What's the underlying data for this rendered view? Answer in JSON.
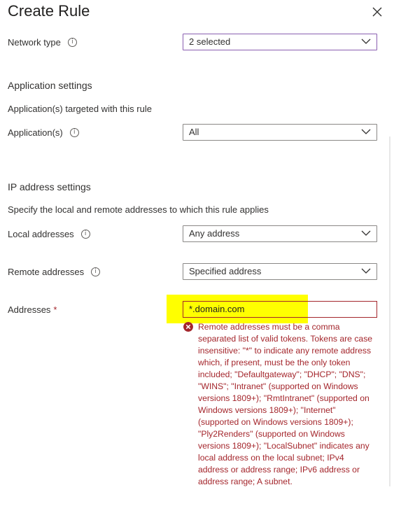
{
  "panel": {
    "title": "Create Rule",
    "close_icon": "close-icon"
  },
  "network": {
    "label": "Network type",
    "value": "2 selected"
  },
  "application_settings": {
    "heading": "Application settings",
    "description": "Application(s) targeted with this rule",
    "label": "Application(s)",
    "value": "All"
  },
  "ip_settings": {
    "heading": "IP address settings",
    "description": "Specify the local and remote addresses to which this rule applies",
    "local_label": "Local addresses",
    "local_value": "Any address",
    "remote_label": "Remote addresses",
    "remote_value": "Specified address",
    "addresses_label": "Addresses",
    "required_marker": "*",
    "addresses_value": "*.domain.com",
    "error_message": "Remote addresses must be a comma separated list of valid tokens. Tokens are case insensitive: \"*\" to indicate any remote address which, if present, must be the only token included; \"Defaultgateway\"; \"DHCP\"; \"DNS\"; \"WINS\"; \"Intranet\" (supported on Windows versions 1809+); \"RmtIntranet\" (supported on Windows versions 1809+); \"Internet\" (supported on Windows versions 1809+); \"Ply2Renders\" (supported on Windows versions 1809+); \"LocalSubnet\" indicates any local address on the local subnet; IPv4 address or address range; IPv6 address or address range; A subnet."
  },
  "colors": {
    "error": "#a4262c",
    "highlight": "#ffff00",
    "focus_border": "#8a5eb0"
  }
}
